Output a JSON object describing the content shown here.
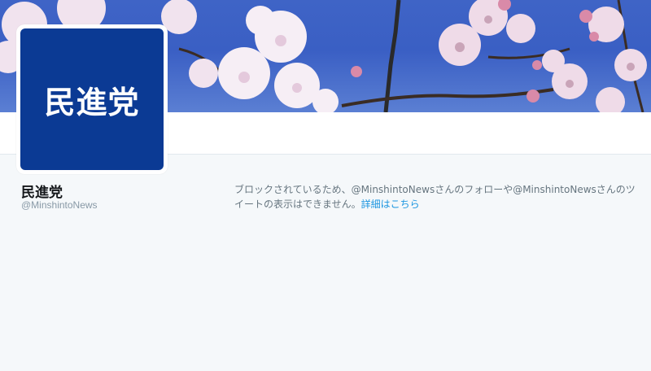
{
  "profile": {
    "avatar_text": "民進党",
    "name": "民進党",
    "handle": "@MinshintoNews"
  },
  "blocked_notice": {
    "message": "ブロックされているため、@MinshintoNewsさんのフォローや@MinshintoNewsさんのツイートの表示はできません。",
    "link_label": "詳細はこちら"
  },
  "colors": {
    "avatar_bg": "#0b3a94",
    "link": "#1b95e0",
    "page_bg": "#f5f8fa"
  }
}
